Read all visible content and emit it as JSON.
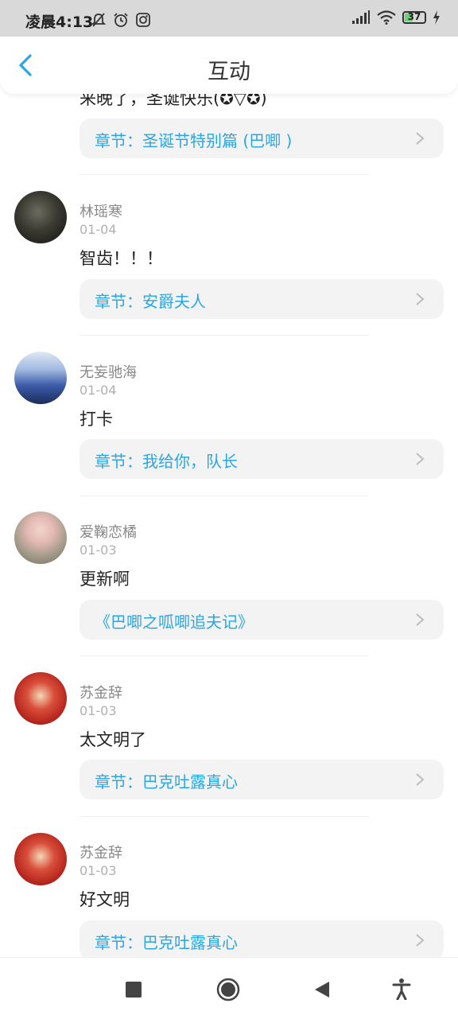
{
  "status_bar": {
    "time": "凌晨4:13",
    "battery": "37",
    "icons": [
      "mute-icon",
      "alarm-icon",
      "instagram-icon",
      "signal-icon",
      "wifi-icon",
      "battery-icon",
      "charging-icon"
    ]
  },
  "header": {
    "title": "互动",
    "back_icon": "chevron-left-icon"
  },
  "colors": {
    "accent": "#2aa6e0",
    "chip_bg": "#f3f3f3",
    "status_bar_bg": "#d9d9d9"
  },
  "partial_comment": {
    "text": "来晚了，圣诞快乐(✪▽✪)",
    "chapter": "章节：圣诞节特别篇 (巴唧 )"
  },
  "comments": [
    {
      "name": "林瑶寒",
      "date": "01-04",
      "text": "智齿！！！",
      "chapter": "章节：安爵夫人"
    },
    {
      "name": "无妄驰海",
      "date": "01-04",
      "text": "打卡",
      "chapter": "章节：我给你，队长"
    },
    {
      "name": "爱鞠恋橘",
      "date": "01-03",
      "text": "更新啊",
      "chapter": "《巴唧之呱唧追夫记》"
    },
    {
      "name": "苏金辞",
      "date": "01-03",
      "text": "太文明了",
      "chapter": "章节：巴克吐露真心"
    },
    {
      "name": "苏金辞",
      "date": "01-03",
      "text": "好文明",
      "chapter": "章节：巴克吐露真心"
    }
  ],
  "nav_bar": {
    "buttons": [
      "recents-button",
      "home-button",
      "back-button",
      "accessibility-button"
    ]
  }
}
